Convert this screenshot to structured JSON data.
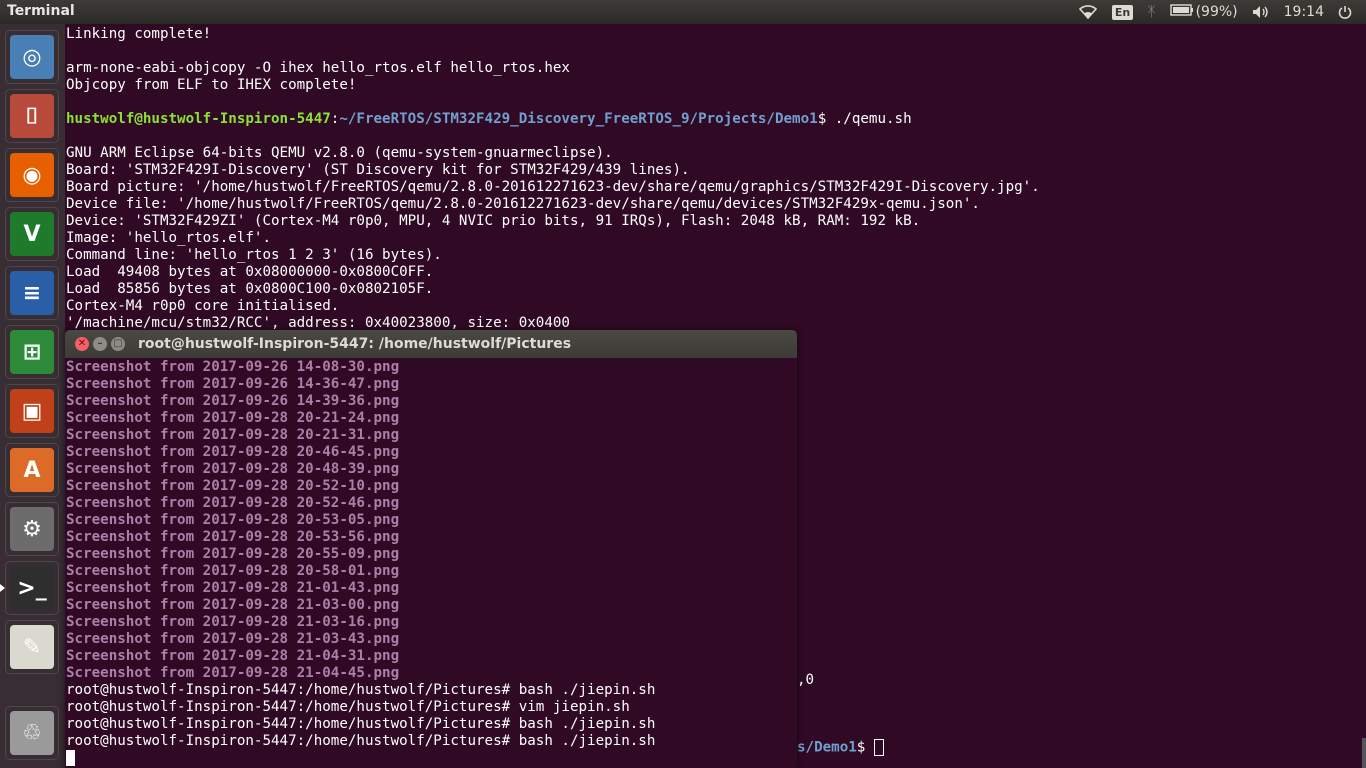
{
  "top_panel": {
    "app_title": "Terminal",
    "keyboard_layout": "En",
    "battery": "(99%)",
    "clock": "19:14",
    "icons": [
      "wifi-icon",
      "bluetooth-icon",
      "battery-icon",
      "volume-icon",
      "power-icon"
    ]
  },
  "launcher": {
    "items": [
      {
        "name": "ubuntu-dash",
        "color": "#4a7fb5"
      },
      {
        "name": "files",
        "color": "#b84a3b"
      },
      {
        "name": "firefox",
        "color": "#e66000"
      },
      {
        "name": "vim",
        "color": "#1f7a2c"
      },
      {
        "name": "libreoffice-writer",
        "color": "#2a5fa8"
      },
      {
        "name": "libreoffice-calc",
        "color": "#2e8b3a"
      },
      {
        "name": "libreoffice-impress",
        "color": "#c0401a"
      },
      {
        "name": "software-center",
        "color": "#dd6b28"
      },
      {
        "name": "system-settings",
        "color": "#6c6c6c"
      },
      {
        "name": "terminal",
        "color": "#2e2e2e"
      },
      {
        "name": "text-editor",
        "color": "#d9d9d0"
      },
      {
        "name": "trash",
        "color": "#9a9a9a"
      }
    ]
  },
  "main_terminal": {
    "lines_top": [
      "Linking complete!",
      "",
      "arm-none-eabi-objcopy -O ihex hello_rtos.elf hello_rtos.hex",
      "Objcopy from ELF to IHEX complete!",
      ""
    ],
    "prompt_user": "hustwolf@hustwolf-Inspiron-5447",
    "prompt_path": "~/FreeRTOS/STM32F429_Discovery_FreeRTOS_9/Projects/Demo1",
    "prompt_cmd": "$ ./qemu.sh",
    "lines_bottom": [
      "",
      "GNU ARM Eclipse 64-bits QEMU v2.8.0 (qemu-system-gnuarmeclipse).",
      "Board: 'STM32F429I-Discovery' (ST Discovery kit for STM32F429/439 lines).",
      "Board picture: '/home/hustwolf/FreeRTOS/qemu/2.8.0-201612271623-dev/share/qemu/graphics/STM32F429I-Discovery.jpg'.",
      "Device file: '/home/hustwolf/FreeRTOS/qemu/2.8.0-201612271623-dev/share/qemu/devices/STM32F429x-qemu.json'.",
      "Device: 'STM32F429ZI' (Cortex-M4 r0p0, MPU, 4 NVIC prio bits, 91 IRQs), Flash: 2048 kB, RAM: 192 kB.",
      "Image: 'hello_rtos.elf'.",
      "Command line: 'hello_rtos 1 2 3' (16 bytes).",
      "Load  49408 bytes at 0x08000000-0x0800C0FF.",
      "Load  85856 bytes at 0x0800C100-0x0802105F.",
      "Cortex-M4 r0p0 core initialised.",
      "'/machine/mcu/stm32/RCC', address: 0x40023800, size: 0x0400"
    ],
    "right_fragment_1": ",0",
    "right_fragment_2_path": "s/Demo1",
    "right_fragment_2_cmd": "$ "
  },
  "front_window": {
    "title": "root@hustwolf-Inspiron-5447: /home/hustwolf/Pictures",
    "files": [
      "Screenshot from 2017-09-26 14-08-30.png",
      "Screenshot from 2017-09-26 14-36-47.png",
      "Screenshot from 2017-09-26 14-39-36.png",
      "Screenshot from 2017-09-28 20-21-24.png",
      "Screenshot from 2017-09-28 20-21-31.png",
      "Screenshot from 2017-09-28 20-46-45.png",
      "Screenshot from 2017-09-28 20-48-39.png",
      "Screenshot from 2017-09-28 20-52-10.png",
      "Screenshot from 2017-09-28 20-52-46.png",
      "Screenshot from 2017-09-28 20-53-05.png",
      "Screenshot from 2017-09-28 20-53-56.png",
      "Screenshot from 2017-09-28 20-55-09.png",
      "Screenshot from 2017-09-28 20-58-01.png",
      "Screenshot from 2017-09-28 21-01-43.png",
      "Screenshot from 2017-09-28 21-03-00.png",
      "Screenshot from 2017-09-28 21-03-16.png",
      "Screenshot from 2017-09-28 21-03-43.png",
      "Screenshot from 2017-09-28 21-04-31.png",
      "Screenshot from 2017-09-28 21-04-45.png"
    ],
    "commands": [
      "root@hustwolf-Inspiron-5447:/home/hustwolf/Pictures# bash ./jiepin.sh",
      "root@hustwolf-Inspiron-5447:/home/hustwolf/Pictures# vim jiepin.sh",
      "root@hustwolf-Inspiron-5447:/home/hustwolf/Pictures# bash ./jiepin.sh",
      "root@hustwolf-Inspiron-5447:/home/hustwolf/Pictures# bash ./jiepin.sh"
    ]
  }
}
